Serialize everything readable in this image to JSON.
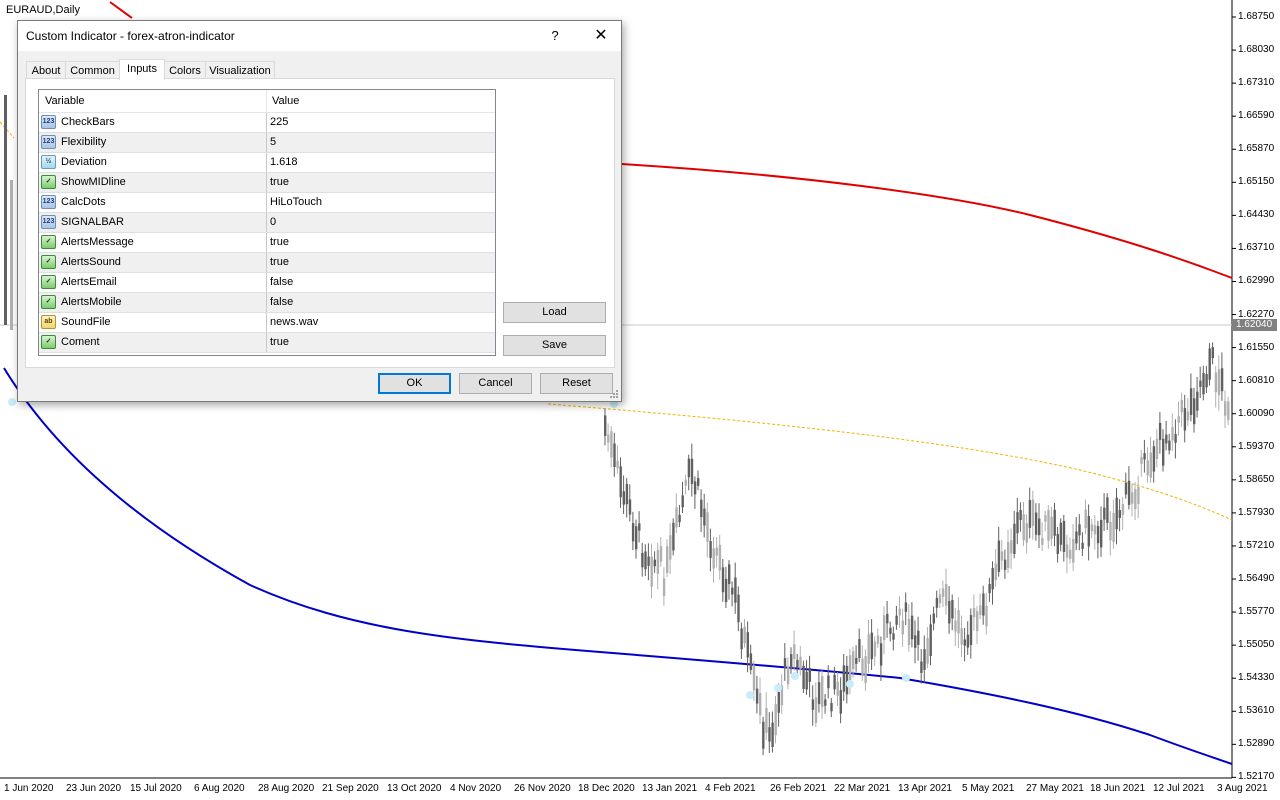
{
  "chart": {
    "symbol": "EURAUD,Daily",
    "current_price": "1.62040",
    "price_ticks": [
      "1.68750",
      "1.68030",
      "1.67310",
      "1.66590",
      "1.65870",
      "1.65150",
      "1.64430",
      "1.63710",
      "1.62990",
      "1.62270",
      "1.61550",
      "1.60810",
      "1.60090",
      "1.59370",
      "1.58650",
      "1.57930",
      "1.57210",
      "1.56490",
      "1.55770",
      "1.55050",
      "1.54330",
      "1.53610",
      "1.52890",
      "1.52170"
    ],
    "date_ticks": [
      "1 Jun 2020",
      "23 Jun 2020",
      "15 Jul 2020",
      "6 Aug 2020",
      "28 Aug 2020",
      "21 Sep 2020",
      "13 Oct 2020",
      "4 Nov 2020",
      "26 Nov 2020",
      "18 Dec 2020",
      "13 Jan 2021",
      "4 Feb 2021",
      "26 Feb 2021",
      "22 Mar 2021",
      "13 Apr 2021",
      "5 May 2021",
      "27 May 2021",
      "18 Jun 2021",
      "12 Jul 2021",
      "3 Aug 2021"
    ],
    "colors": {
      "upper_band": "#e00000",
      "lower_band": "#0000c8",
      "mid_line": "#f0b400",
      "bull_candle": "#b0b0b0",
      "bear_candle": "#606060",
      "dots": "#c8ecf8"
    }
  },
  "dialog": {
    "title": "Custom Indicator - forex-atron-indicator",
    "help_label": "?",
    "close_label": "✕",
    "tabs": [
      "About",
      "Common",
      "Inputs",
      "Colors",
      "Visualization"
    ],
    "active_tab": "Inputs",
    "grid": {
      "col_variable": "Variable",
      "col_value": "Value",
      "rows": [
        {
          "icon": "int-icon",
          "type": "int",
          "badge": "123",
          "name": "CheckBars",
          "value": "225"
        },
        {
          "icon": "int-icon",
          "type": "int",
          "badge": "123",
          "name": "Flexibility",
          "value": "5"
        },
        {
          "icon": "double-icon",
          "type": "dbl",
          "badge": "½",
          "name": "Deviation",
          "value": "1.618"
        },
        {
          "icon": "bool-icon",
          "type": "bool",
          "badge": "✓",
          "name": "ShowMIDline",
          "value": "true"
        },
        {
          "icon": "int-icon",
          "type": "int",
          "badge": "123",
          "name": "CalcDots",
          "value": "HiLoTouch"
        },
        {
          "icon": "int-icon",
          "type": "int",
          "badge": "123",
          "name": "SIGNALBAR",
          "value": "0"
        },
        {
          "icon": "bool-icon",
          "type": "bool",
          "badge": "✓",
          "name": "AlertsMessage",
          "value": "true"
        },
        {
          "icon": "bool-icon",
          "type": "bool",
          "badge": "✓",
          "name": "AlertsSound",
          "value": "true"
        },
        {
          "icon": "bool-icon",
          "type": "bool",
          "badge": "✓",
          "name": "AlertsEmail",
          "value": "false"
        },
        {
          "icon": "bool-icon",
          "type": "bool",
          "badge": "✓",
          "name": "AlertsMobile",
          "value": "false"
        },
        {
          "icon": "string-icon",
          "type": "str",
          "badge": "ab",
          "name": "SoundFile",
          "value": "news.wav"
        },
        {
          "icon": "bool-icon",
          "type": "bool",
          "badge": "✓",
          "name": "Coment",
          "value": "true"
        }
      ]
    },
    "buttons": {
      "load": "Load",
      "save": "Save",
      "ok": "OK",
      "cancel": "Cancel",
      "reset": "Reset"
    }
  }
}
